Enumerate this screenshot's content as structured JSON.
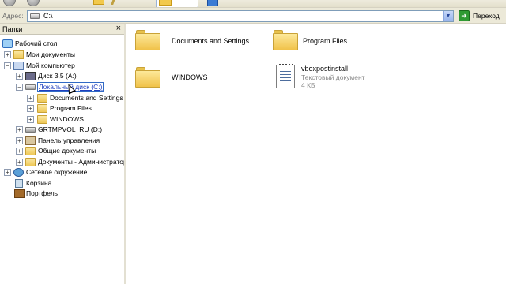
{
  "address": {
    "label": "Адрес:",
    "value": "C:\\",
    "go_label": "Переход"
  },
  "folders_pane": {
    "title": "Папки",
    "close_glyph": "×",
    "tree": [
      {
        "label": "Рабочий стол",
        "icon": "desktop-icon"
      },
      {
        "label": "Мои документы",
        "icon": "my-documents-icon",
        "expander": "+"
      },
      {
        "label": "Мой компьютер",
        "icon": "my-computer-icon",
        "expander": "−"
      },
      {
        "label": "Диск 3,5 (A:)",
        "icon": "floppy-icon",
        "expander": "+"
      },
      {
        "label": "Локальный диск (C:)",
        "icon": "local-disk-icon",
        "expander": "−",
        "selected": true
      },
      {
        "label": "Documents and Settings",
        "icon": "folder-icon",
        "expander": "+"
      },
      {
        "label": "Program Files",
        "icon": "folder-icon",
        "expander": "+"
      },
      {
        "label": "WINDOWS",
        "icon": "folder-icon",
        "expander": "+"
      },
      {
        "label": "GRTMPVOL_RU (D:)",
        "icon": "cd-drive-icon",
        "expander": "+"
      },
      {
        "label": "Панель управления",
        "icon": "control-panel-icon",
        "expander": "+"
      },
      {
        "label": "Общие документы",
        "icon": "folder-icon",
        "expander": "+"
      },
      {
        "label": "Документы - Администратор",
        "icon": "folder-icon",
        "expander": "+"
      },
      {
        "label": "Сетевое окружение",
        "icon": "network-icon",
        "expander": "+"
      },
      {
        "label": "Корзина",
        "icon": "recycle-bin-icon"
      },
      {
        "label": "Портфель",
        "icon": "briefcase-icon"
      }
    ]
  },
  "content": {
    "items": [
      {
        "name": "Documents and Settings",
        "icon": "folder-icon"
      },
      {
        "name": "Program Files",
        "icon": "folder-icon"
      },
      {
        "name": "WINDOWS",
        "icon": "folder-icon"
      },
      {
        "name": "vboxpostinstall",
        "type": "Текстовый документ",
        "size": "4 КБ",
        "icon": "text-document-icon"
      }
    ]
  },
  "colors": {
    "selection_border": "#316ac5",
    "pane_background": "#ece9d8",
    "go_button": "#2f9a32"
  }
}
